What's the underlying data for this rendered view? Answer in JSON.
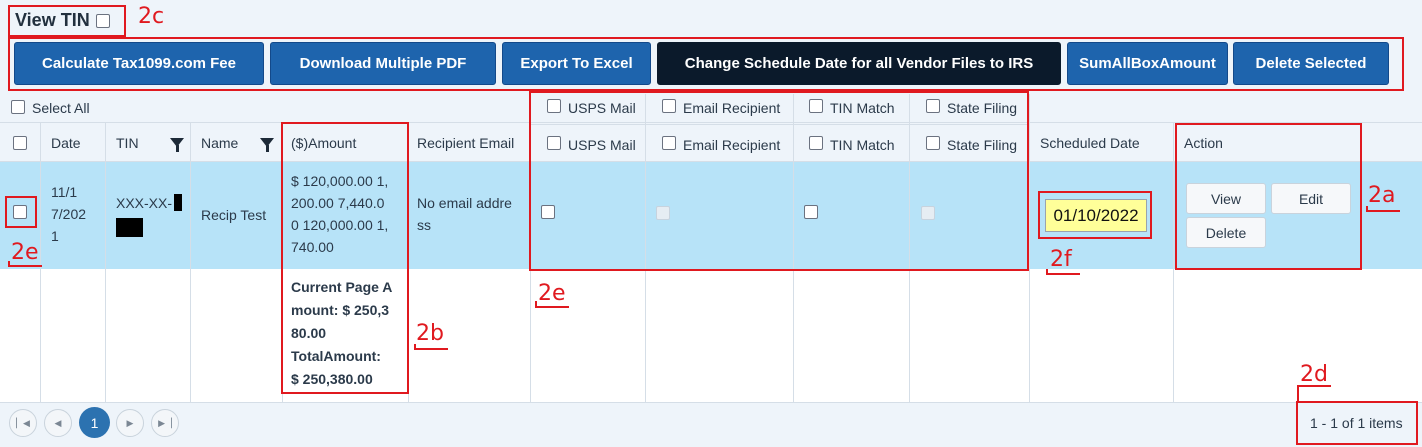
{
  "top": {
    "view_tin_label": "View TIN",
    "buttons": {
      "calc_fee": "Calculate Tax1099.com Fee",
      "download_pdf": "Download Multiple PDF",
      "export_excel": "Export To Excel",
      "change_schedule": "Change Schedule Date for all Vendor Files to IRS",
      "sum_box": "SumAllBoxAmount",
      "delete_selected": "Delete Selected"
    }
  },
  "group_header": {
    "select_all": "Select All",
    "usps_mail": "USPS Mail",
    "email_recipient": "Email Recipient",
    "tin_match": "TIN Match",
    "state_filing": "State Filing"
  },
  "columns": {
    "date": "Date",
    "tin": "TIN",
    "name": "Name",
    "amount": "($)Amount",
    "recipient_email": "Recipient Email",
    "usps_mail": "USPS Mail",
    "email_recipient": "Email Recipient",
    "tin_match": "TIN Match",
    "state_filing": "State Filing",
    "scheduled_date": "Scheduled Date",
    "action": "Action"
  },
  "row": {
    "date_lines": [
      "11/1",
      "7/202",
      "1"
    ],
    "tin_prefix": "XXX-XX-",
    "name": "Recip Test",
    "amount_lines": [
      "$ 120,000.00 1,",
      "200.00 7,440.0",
      "0 120,000.00 1,",
      "740.00"
    ],
    "email_lines": [
      "No email addre",
      "ss"
    ],
    "scheduled_date": "01/10/2022",
    "actions": {
      "view": "View",
      "edit": "Edit",
      "delete": "Delete"
    }
  },
  "totals": {
    "lines": [
      "Current Page A",
      "mount: $ 250,3",
      "80.00",
      "TotalAmount:",
      "$ 250,380.00"
    ]
  },
  "pager": {
    "current_page": "1",
    "info": "1 - 1 of 1 items"
  },
  "annotations": {
    "a": "2a",
    "b": "2b",
    "c": "2c",
    "d": "2d",
    "e1": "2e",
    "e2": "2e",
    "f": "2f"
  },
  "colors": {
    "primary_button": "#1e64ad",
    "dark_button": "#0b1a2b",
    "selected_row": "#b7e3f8",
    "annotation": "#e0191f",
    "date_highlight": "#ffff99"
  }
}
